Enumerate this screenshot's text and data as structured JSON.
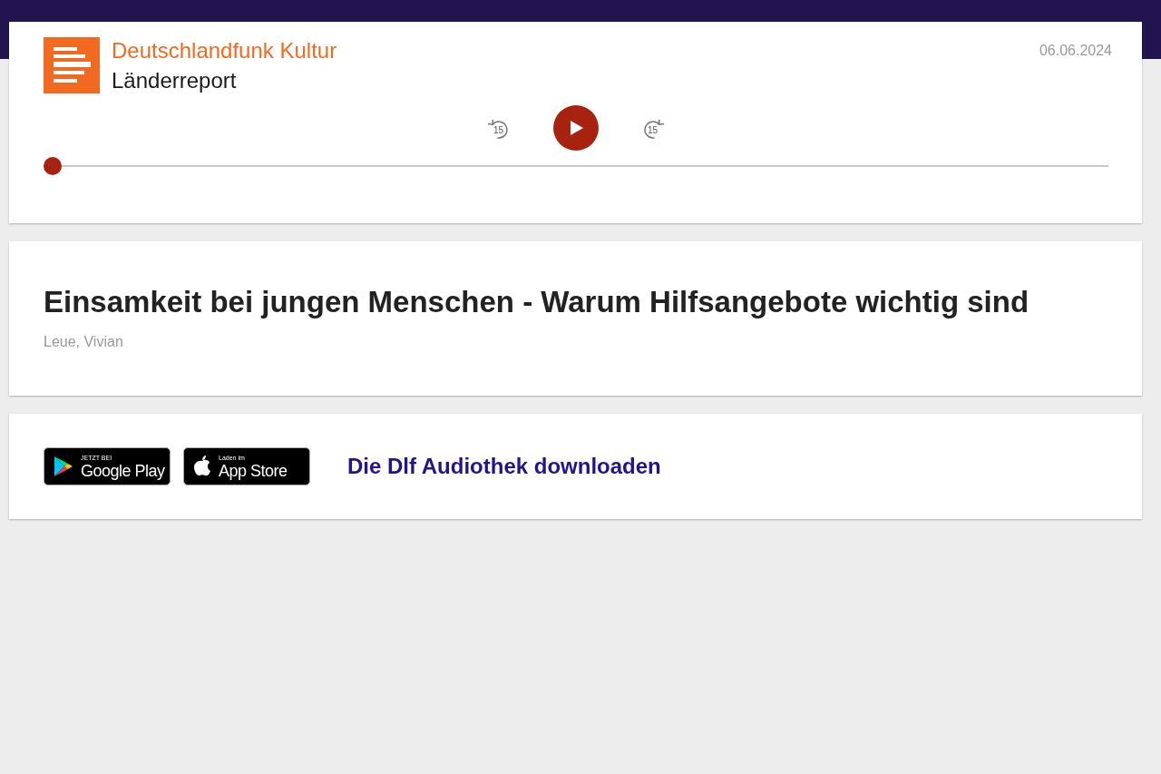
{
  "player": {
    "station": "Deutschlandfunk Kultur",
    "program": "Länderreport",
    "date": "06.06.2024",
    "skip_back": "15",
    "skip_forward": "15",
    "playing": false,
    "progress": {
      "level": 0
    }
  },
  "episode": {
    "title": "Einsamkeit bei jungen Menschen - Warum Hilfsangebote wichtig sind",
    "author": "Leue, Vivian"
  },
  "download": {
    "badges": [
      {
        "kind": "google",
        "small": "JETZT BEI",
        "large": "Google Play"
      },
      {
        "kind": "apple",
        "small": "Laden im",
        "large": "App Store"
      }
    ],
    "link": "Die Dlf Audiothek downloaden"
  }
}
